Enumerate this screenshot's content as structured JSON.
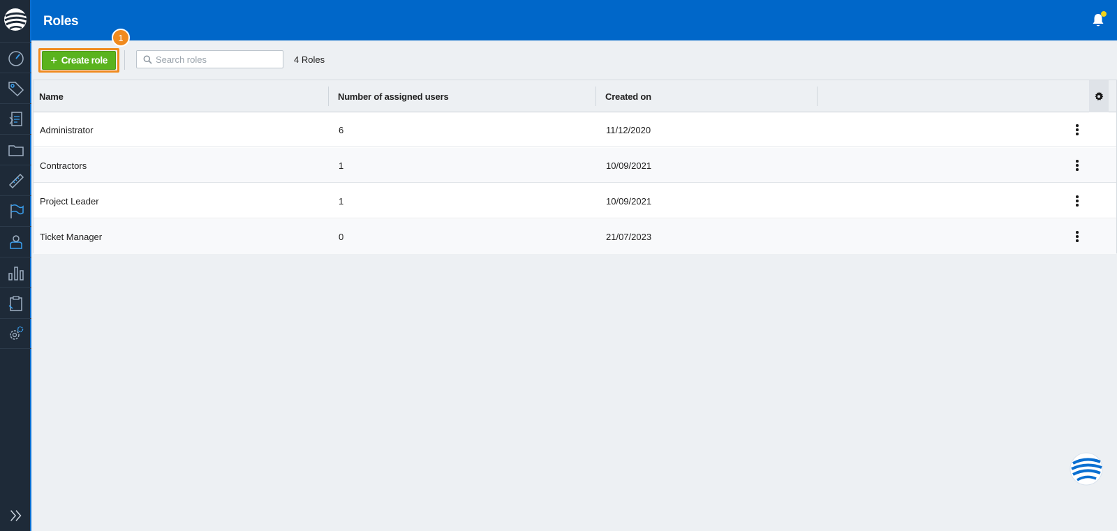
{
  "header": {
    "title": "Roles"
  },
  "toolbar": {
    "create_label": "Create role",
    "step_number": "1",
    "search_placeholder": "Search roles",
    "search_value": "",
    "role_count": "4 Roles"
  },
  "table": {
    "columns": [
      "Name",
      "Number of assigned users",
      "Created on"
    ],
    "rows": [
      {
        "name": "Administrator",
        "users": "6",
        "created": "11/12/2020"
      },
      {
        "name": "Contractors",
        "users": "1",
        "created": "10/09/2021"
      },
      {
        "name": "Project Leader",
        "users": "1",
        "created": "10/09/2021"
      },
      {
        "name": "Ticket Manager",
        "users": "0",
        "created": "21/07/2023"
      }
    ]
  },
  "sidebar": {
    "icons": [
      "dashboard-icon",
      "tags-icon",
      "documents-icon",
      "folder-icon",
      "ruler-icon",
      "flag-icon",
      "user-icon",
      "chart-icon",
      "clipboard-icon",
      "settings-icon"
    ]
  },
  "colors": {
    "header": "#0067c9",
    "sidebar": "#1e2a38",
    "create_button": "#5ab31e",
    "highlight": "#f08a1e",
    "notification_dot": "#f2d21a"
  }
}
